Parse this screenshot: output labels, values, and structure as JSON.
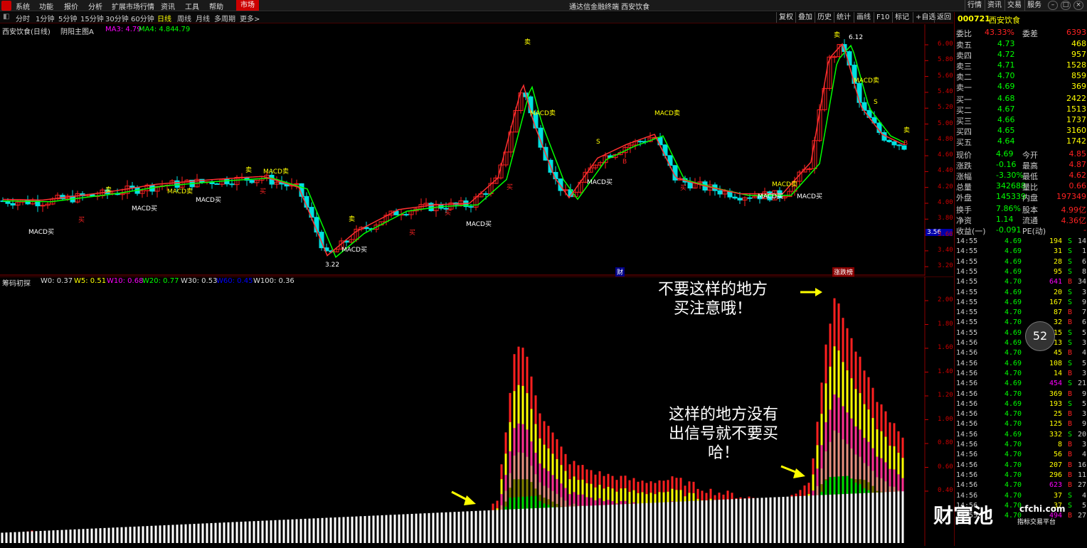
{
  "menubar": {
    "items": [
      "系统",
      "功能",
      "报价",
      "分析",
      "扩展市场行情",
      "资讯",
      "工具",
      "帮助"
    ],
    "market_tab": "市场",
    "title": "通达信金融终端 西安饮食",
    "right_tabs": [
      "行情",
      "资讯",
      "交易",
      "服务"
    ]
  },
  "periodbar": {
    "periods": [
      "分时",
      "1分钟",
      "5分钟",
      "15分钟",
      "30分钟",
      "60分钟",
      "日线",
      "周线",
      "月线",
      "多周期",
      "更多>"
    ],
    "active": "日线",
    "tools": [
      "复权",
      "叠加",
      "历史",
      "统计",
      "画线",
      "F10",
      "标记",
      "+自选",
      "返回"
    ]
  },
  "main_chart": {
    "stock_label": "西安饮食(日线)",
    "indicator": "阴阳主图A",
    "ma3": "MA3: 4.79",
    "ma4": "MA4: 4.84",
    "ma5": "4.79",
    "high_label": "6.12",
    "low_label": "3.22",
    "cursor_price": "3.56",
    "finance_tag": "财",
    "event_tag": "涨跌榜",
    "price_axis": [
      "6.00",
      "5.80",
      "5.60",
      "5.40",
      "5.20",
      "5.00",
      "4.80",
      "4.60",
      "4.40",
      "4.20",
      "4.00",
      "3.80",
      "3.60",
      "3.40",
      "3.20"
    ]
  },
  "sub_chart": {
    "indicator": "筹码初探",
    "w0": "W0: 0.37",
    "w5": "W5: 0.51",
    "w10": "W10: 0.68",
    "w20": "W20: 0.77",
    "w30": "W30: 0.53",
    "w60": "W60: 0.45",
    "w100": "W100: 0.36",
    "axis": [
      "2.00",
      "1.80",
      "1.60",
      "1.40",
      "1.20",
      "1.00",
      "0.80",
      "0.60",
      "0.40"
    ]
  },
  "annotations": {
    "top": "不要这样的地方\n买注意哦！",
    "bottom": "这样的地方没有\n出信号就不要买\n哈！"
  },
  "quote": {
    "code": "000721",
    "name": "西安饮食",
    "weibi_label": "委比",
    "weibi": "43.33%",
    "weicha_label": "委差",
    "weicha": "6393",
    "asks": [
      {
        "label": "卖五",
        "price": "4.73",
        "vol": "468"
      },
      {
        "label": "卖四",
        "price": "4.72",
        "vol": "957"
      },
      {
        "label": "卖三",
        "price": "4.71",
        "vol": "1528"
      },
      {
        "label": "卖二",
        "price": "4.70",
        "vol": "859"
      },
      {
        "label": "卖一",
        "price": "4.69",
        "vol": "369"
      }
    ],
    "bids": [
      {
        "label": "买一",
        "price": "4.68",
        "vol": "2422"
      },
      {
        "label": "买二",
        "price": "4.67",
        "vol": "1513"
      },
      {
        "label": "买三",
        "price": "4.66",
        "vol": "1737"
      },
      {
        "label": "买四",
        "price": "4.65",
        "vol": "3160"
      },
      {
        "label": "买五",
        "price": "4.64",
        "vol": "1742"
      }
    ],
    "stats": [
      {
        "l1": "现价",
        "v1": "4.69",
        "l2": "今开",
        "v2": "4.85"
      },
      {
        "l1": "涨跌",
        "v1": "-0.16",
        "l2": "最高",
        "v2": "4.87"
      },
      {
        "l1": "涨幅",
        "v1": "-3.30%",
        "l2": "最低",
        "v2": "4.62"
      },
      {
        "l1": "总量",
        "v1": "342688",
        "l2": "量比",
        "v2": "0.66"
      },
      {
        "l1": "外盘",
        "v1": "145339",
        "l2": "内盘",
        "v2": "197349"
      }
    ],
    "stats2": [
      {
        "l1": "换手",
        "v1": "7.86%",
        "l2": "股本",
        "v2": "4.99亿"
      },
      {
        "l1": "净资",
        "v1": "1.14",
        "l2": "流通",
        "v2": "4.36亿"
      },
      {
        "l1": "收益(一)",
        "v1": "-0.091",
        "l2": "PE(动)",
        "v2": "-"
      }
    ]
  },
  "ticks": [
    {
      "t": "14:55",
      "p": "4.69",
      "v": "194",
      "d": "S",
      "n": "14"
    },
    {
      "t": "14:55",
      "p": "4.69",
      "v": "31",
      "d": "S",
      "n": "1"
    },
    {
      "t": "14:55",
      "p": "4.69",
      "v": "28",
      "d": "S",
      "n": "6"
    },
    {
      "t": "14:55",
      "p": "4.69",
      "v": "95",
      "d": "S",
      "n": "8"
    },
    {
      "t": "14:55",
      "p": "4.70",
      "v": "641",
      "d": "B",
      "n": "34"
    },
    {
      "t": "14:55",
      "p": "4.69",
      "v": "20",
      "d": "S",
      "n": "3"
    },
    {
      "t": "14:55",
      "p": "4.69",
      "v": "167",
      "d": "S",
      "n": "9"
    },
    {
      "t": "14:55",
      "p": "4.70",
      "v": "87",
      "d": "B",
      "n": "7"
    },
    {
      "t": "14:55",
      "p": "4.70",
      "v": "32",
      "d": "B",
      "n": "6"
    },
    {
      "t": "14:55",
      "p": "4.69",
      "v": "15",
      "d": "S",
      "n": "5"
    },
    {
      "t": "14:56",
      "p": "4.69",
      "v": "13",
      "d": "S",
      "n": "3"
    },
    {
      "t": "14:56",
      "p": "4.70",
      "v": "45",
      "d": "B",
      "n": "4"
    },
    {
      "t": "14:56",
      "p": "4.69",
      "v": "108",
      "d": "S",
      "n": "5"
    },
    {
      "t": "14:56",
      "p": "4.70",
      "v": "14",
      "d": "B",
      "n": "3"
    },
    {
      "t": "14:56",
      "p": "4.69",
      "v": "454",
      "d": "S",
      "n": "21"
    },
    {
      "t": "14:56",
      "p": "4.70",
      "v": "369",
      "d": "B",
      "n": "9"
    },
    {
      "t": "14:56",
      "p": "4.69",
      "v": "193",
      "d": "S",
      "n": "5"
    },
    {
      "t": "14:56",
      "p": "4.70",
      "v": "25",
      "d": "B",
      "n": "3"
    },
    {
      "t": "14:56",
      "p": "4.70",
      "v": "125",
      "d": "B",
      "n": "9"
    },
    {
      "t": "14:56",
      "p": "4.69",
      "v": "332",
      "d": "S",
      "n": "20"
    },
    {
      "t": "14:56",
      "p": "4.70",
      "v": "8",
      "d": "B",
      "n": "3"
    },
    {
      "t": "14:56",
      "p": "4.70",
      "v": "56",
      "d": "B",
      "n": "4"
    },
    {
      "t": "14:56",
      "p": "4.70",
      "v": "207",
      "d": "B",
      "n": "16"
    },
    {
      "t": "14:56",
      "p": "4.70",
      "v": "296",
      "d": "B",
      "n": "11"
    },
    {
      "t": "14:56",
      "p": "4.70",
      "v": "623",
      "d": "B",
      "n": "27"
    },
    {
      "t": "14:56",
      "p": "4.70",
      "v": "37",
      "d": "S",
      "n": "4"
    },
    {
      "t": "14:56",
      "p": "4.70",
      "v": "37",
      "d": "S",
      "n": "5"
    },
    {
      "t": "14:55",
      "p": "4.70",
      "v": "494",
      "d": "B",
      "n": "27"
    }
  ],
  "timer": "52",
  "watermark": {
    "brand": "财富池",
    "site": "cfchi.com",
    "tagline": "指标交易平台"
  },
  "signals": [
    "MACD买",
    "MACD卖",
    "卖",
    "买",
    "S",
    "B"
  ],
  "colors": {
    "up": "#ff2020",
    "down": "#00e0e0",
    "ma_fast": "#ff3030",
    "ma_slow": "#00ff00",
    "grid": "#800000",
    "accent": "#ffff00"
  }
}
